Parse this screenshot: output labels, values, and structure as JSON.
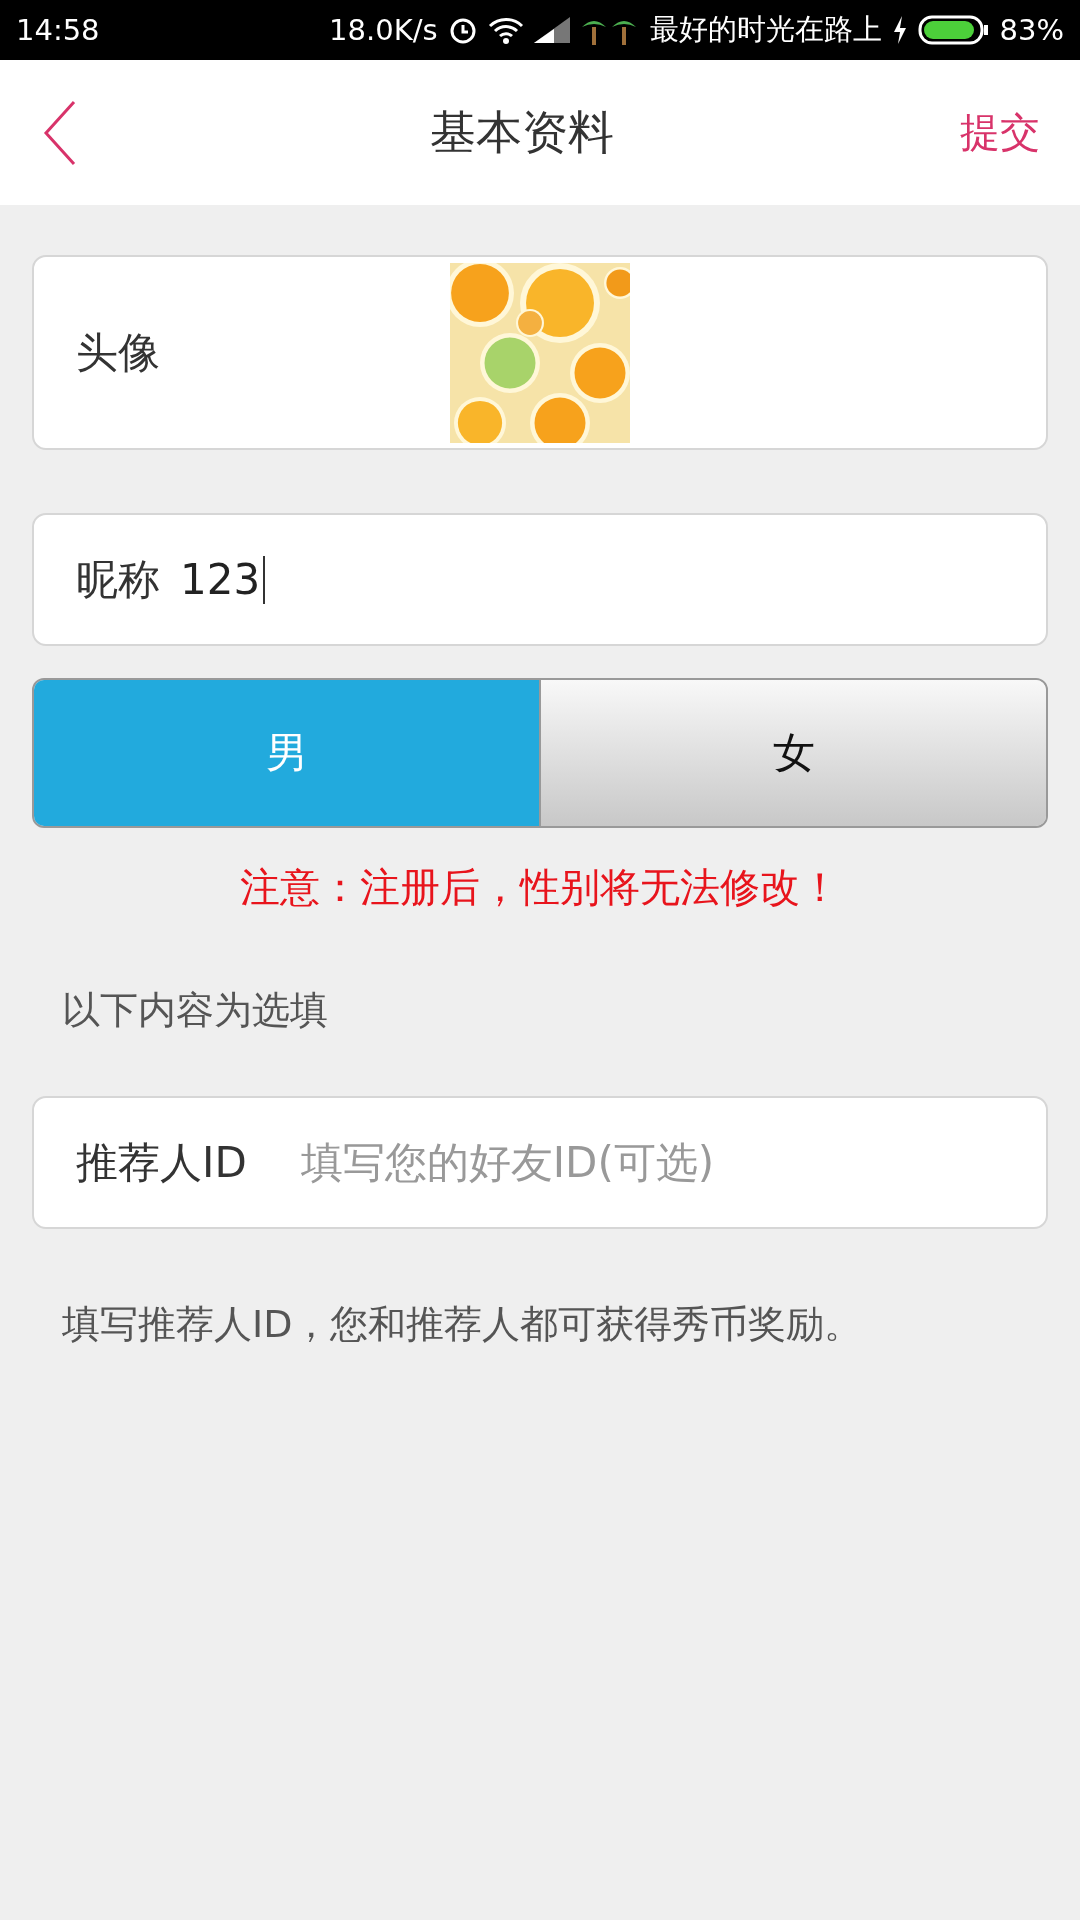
{
  "status_bar": {
    "time": "14:58",
    "speed": "18.0K/s",
    "carrier": "最好的时光在路上",
    "battery": "83%"
  },
  "header": {
    "title": "基本资料",
    "action": "提交"
  },
  "avatar": {
    "label": "头像",
    "kind": "picture"
  },
  "nickname": {
    "label": "昵称",
    "value": "123"
  },
  "gender": [
    {
      "label": "男",
      "selected": true
    },
    {
      "label": "女",
      "selected": false
    }
  ],
  "notice": "注意：注册后，性别将无法修改！",
  "optional_heading": "以下内容为选填",
  "referrer": {
    "label": "推荐人ID",
    "placeholder": "填写您的好友ID(可选)"
  },
  "hint": "填写推荐人ID，您和推荐人都可获得秀币奖励。"
}
